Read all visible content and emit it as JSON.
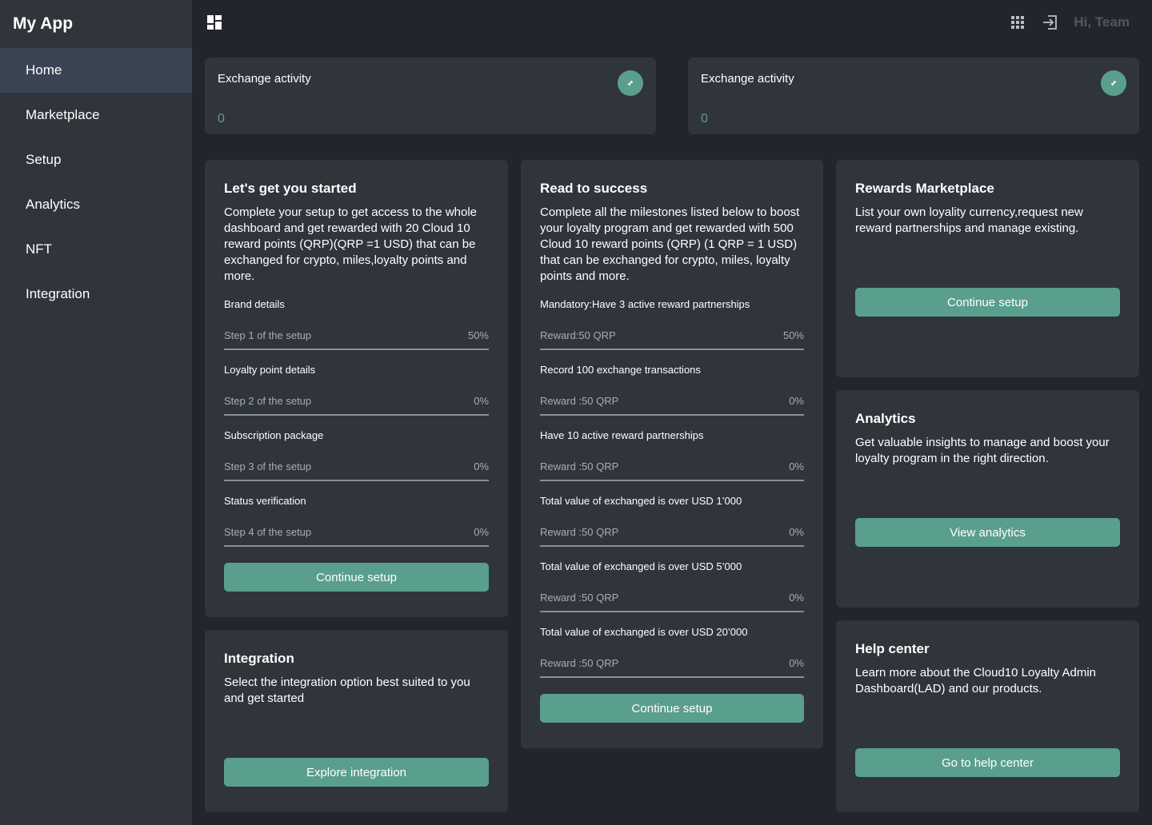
{
  "app": {
    "title": "My App"
  },
  "sidebar": {
    "items": [
      {
        "label": "Home"
      },
      {
        "label": "Marketplace"
      },
      {
        "label": "Setup"
      },
      {
        "label": "Analytics"
      },
      {
        "label": "NFT"
      },
      {
        "label": "Integration"
      }
    ],
    "active_index": 0
  },
  "topbar": {
    "greeting": "Hi, Team"
  },
  "stats": [
    {
      "title": "Exchange activity",
      "value": "0"
    },
    {
      "title": "Exchange activity",
      "value": "0"
    }
  ],
  "getting_started": {
    "title": "Let's get you started",
    "description": "Complete your setup to get access to the whole dashboard and get rewarded with 20 Cloud 10 reward points (QRP)(QRP =1 USD) that can be exchanged for crypto, miles,loyalty points and more.",
    "steps": [
      {
        "title": "Brand details",
        "subtitle": "Step 1 of the setup",
        "percent": "50%"
      },
      {
        "title": "Loyalty point details",
        "subtitle": "Step 2 of the setup",
        "percent": "0%"
      },
      {
        "title": "Subscription package",
        "subtitle": "Step 3 of the setup",
        "percent": "0%"
      },
      {
        "title": "Status verification",
        "subtitle": "Step 4 of the setup",
        "percent": "0%"
      }
    ],
    "button": "Continue setup"
  },
  "read_to_success": {
    "title": "Read to success",
    "description": "Complete all the milestones listed below to boost your loyalty program and get rewarded with 500 Cloud 10 reward points (QRP) (1 QRP = 1 USD) that can be exchanged for crypto, miles, loyalty points and more.",
    "milestones": [
      {
        "title": "Mandatory:Have 3 active reward partnerships",
        "reward": "Reward:50 QRP",
        "percent": "50%"
      },
      {
        "title": "Record 100 exchange transactions",
        "reward": "Reward :50 QRP",
        "percent": "0%"
      },
      {
        "title": "Have 10 active reward partnerships",
        "reward": "Reward :50 QRP",
        "percent": "0%"
      },
      {
        "title": "Total value of exchanged is over USD 1’000",
        "reward": "Reward :50 QRP",
        "percent": "0%"
      },
      {
        "title": "Total value of exchanged is over USD 5’000",
        "reward": "Reward :50 QRP",
        "percent": "0%"
      },
      {
        "title": "Total value of exchanged is over USD 20’000",
        "reward": "Reward :50 QRP",
        "percent": "0%"
      }
    ],
    "button": "Continue setup"
  },
  "integration": {
    "title": "Integration",
    "description": "Select the integration option best suited to you and get started",
    "button": "Explore integration"
  },
  "rewards_marketplace": {
    "title": "Rewards Marketplace",
    "description": "List your own loyality currency,request new reward partnerships and manage existing.",
    "button": "Continue setup"
  },
  "analytics": {
    "title": "Analytics",
    "description": "Get valuable insights to manage and boost your loyalty program in the right direction.",
    "button": "View analytics"
  },
  "help_center": {
    "title": "Help center",
    "description": "Learn more about the Cloud10 Loyalty Admin Dashboard(LAD) and our products.",
    "button": "Go to help center"
  },
  "colors": {
    "accent": "#5a9e8e",
    "sidebar_bg": "#30343b",
    "page_bg": "#22252c",
    "active_nav_bg": "#3b4453"
  },
  "icons": {
    "topbar_left": "dashboard-icon",
    "apps": "apps-grid-icon",
    "logout": "logout-icon",
    "stat_badge": "expand-icon"
  }
}
